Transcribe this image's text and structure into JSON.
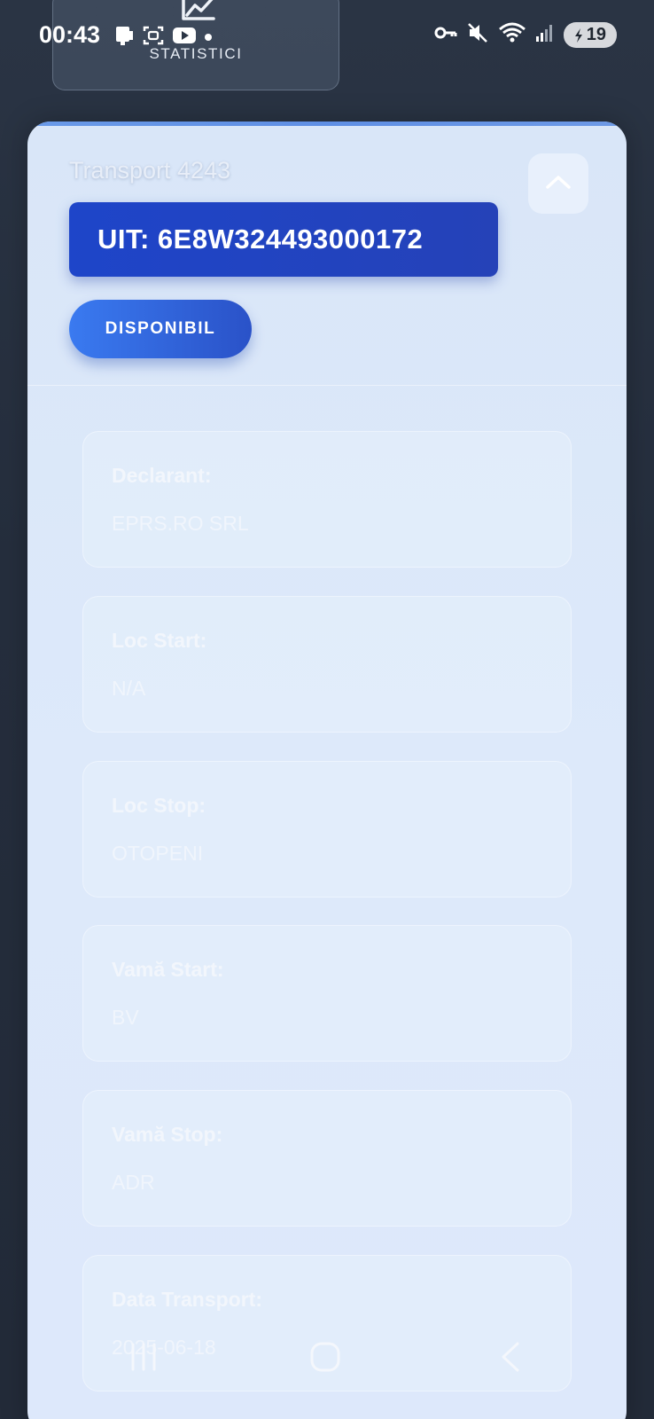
{
  "status_bar": {
    "time": "00:43",
    "battery": "19",
    "left_icons": [
      "sim-icon",
      "screenshot-icon",
      "youtube-icon",
      "dot-icon"
    ],
    "right_icons": [
      "vpn-key-icon",
      "mute-icon",
      "wifi-icon",
      "signal-icon",
      "battery-icon"
    ]
  },
  "top_tab": {
    "label": "STATISTICI",
    "icon": "chart-line-icon"
  },
  "card": {
    "title": "Transport 4243",
    "uit": "UIT: 6E8W324493000172",
    "status": "DISPONIBIL",
    "collapse_icon": "chevron-up-icon",
    "fields": [
      {
        "label": "Declarant:",
        "value": "EPRS.RO SRL"
      },
      {
        "label": "Loc Start:",
        "value": "N/A"
      },
      {
        "label": "Loc Stop:",
        "value": "OTOPENI"
      },
      {
        "label": "Vamă Start:",
        "value": "BV"
      },
      {
        "label": "Vamă Stop:",
        "value": "ADR"
      },
      {
        "label": "Data Transport:",
        "value": "2025-06-18"
      }
    ]
  },
  "nav": {
    "recents_icon": "recents-icon",
    "home_icon": "home-icon",
    "back_icon": "back-icon"
  },
  "colors": {
    "accent": "#1e45c9",
    "chip": "#3a7af0",
    "background": "#252e3d",
    "card": "#dde8fb"
  }
}
